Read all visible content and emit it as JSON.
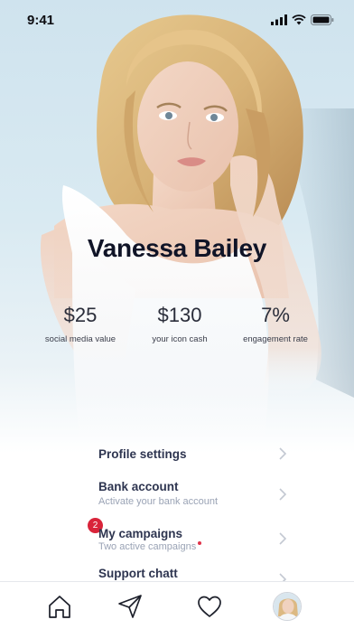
{
  "status_bar": {
    "time": "9:41"
  },
  "profile": {
    "name": "Vanessa Bailey"
  },
  "stats": [
    {
      "value": "$25",
      "label": "social media value"
    },
    {
      "value": "$130",
      "label": "your icon cash"
    },
    {
      "value": "7%",
      "label": "engagement rate"
    }
  ],
  "menu": {
    "profile_settings": {
      "title": "Profile settings"
    },
    "bank_account": {
      "title": "Bank account",
      "subtitle": "Activate your bank account"
    },
    "my_campaigns": {
      "title": "My campaigns",
      "subtitle": "Two active campaigns",
      "badge": "2"
    },
    "support": {
      "title": "Support chatt"
    }
  },
  "tab_bar": {
    "items": [
      "home-icon",
      "send-icon",
      "heart-icon",
      "profile-avatar"
    ]
  },
  "colors": {
    "name_text": "#101427",
    "menu_title": "#2e3550",
    "menu_subtitle": "#9aa3b5",
    "badge": "#d9243a",
    "hero_background": "#cfe3ee"
  }
}
